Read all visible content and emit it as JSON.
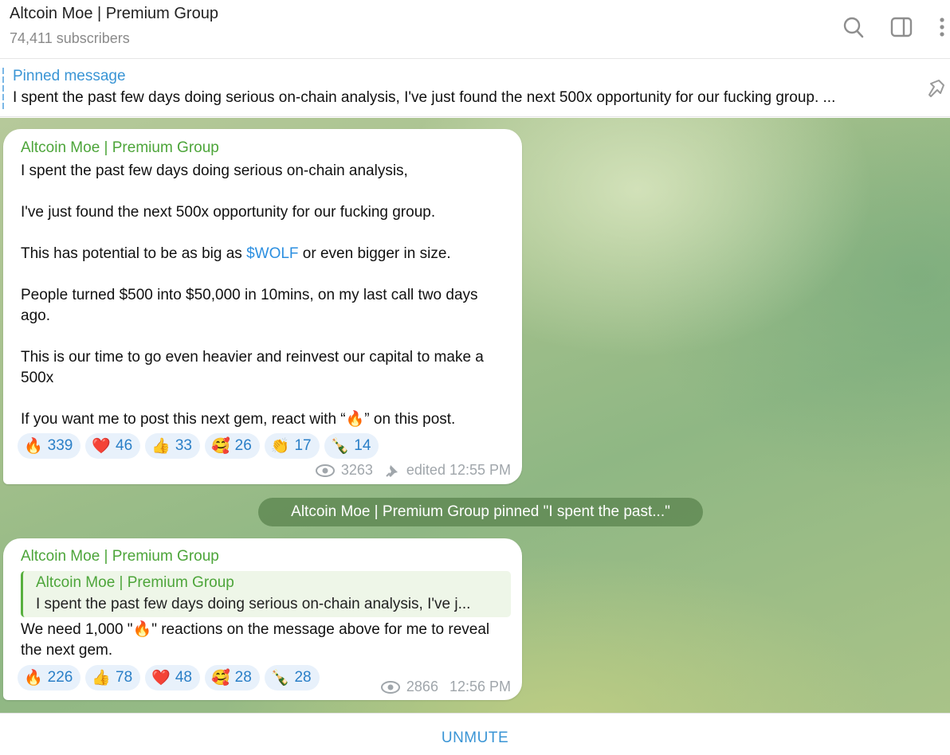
{
  "header": {
    "title": "Altcoin Moe | Premium Group",
    "subscribers": "74,411 subscribers"
  },
  "pinned": {
    "label": "Pinned message",
    "text": "I spent the past few days doing serious on-chain analysis,   I've just found the next 500x opportunity for our fucking group. ..."
  },
  "message1": {
    "sender": "Altcoin Moe | Premium Group",
    "line1": "I spent the past few days doing serious on-chain analysis,",
    "line2": "I've just found the next 500x opportunity for our fucking group.",
    "line3_pre": "This has potential to be as big as ",
    "line3_link": "$WOLF",
    "line3_post": " or even bigger in size.",
    "line4": "People turned $500 into $50,000 in 10mins, on my last call two days ago.",
    "line5": "This is our time to go even heavier and reinvest our capital to make a 500x",
    "line6": "If you want me to post this next gem, react with “🔥” on this post.",
    "reactions": [
      {
        "emoji": "🔥",
        "count": "339"
      },
      {
        "emoji": "❤️",
        "count": "46"
      },
      {
        "emoji": "👍",
        "count": "33"
      },
      {
        "emoji": "🥰",
        "count": "26"
      },
      {
        "emoji": "👏",
        "count": "17"
      },
      {
        "emoji": "🍾",
        "count": "14"
      }
    ],
    "views": "3263",
    "time": "edited 12:55 PM"
  },
  "service": {
    "text": "Altcoin Moe | Premium Group pinned \"I spent the past...\""
  },
  "message2": {
    "sender": "Altcoin Moe | Premium Group",
    "reply_name": "Altcoin Moe | Premium Group",
    "reply_text": "I spent the past few days doing serious on-chain analysis,   I've j...",
    "text": "We need 1,000 \"🔥\" reactions on the message above for me to reveal the next gem.",
    "reactions": [
      {
        "emoji": "🔥",
        "count": "226"
      },
      {
        "emoji": "👍",
        "count": "78"
      },
      {
        "emoji": "❤️",
        "count": "48"
      },
      {
        "emoji": "🥰",
        "count": "28"
      },
      {
        "emoji": "🍾",
        "count": "28"
      }
    ],
    "views": "2866",
    "time": "12:56 PM"
  },
  "footer": {
    "button": "UNMUTE"
  },
  "icons": {
    "header": [
      "search-icon",
      "sidebar-toggle-icon",
      "more-options-icon"
    ],
    "pinned": "pin-icon",
    "meta": [
      "eye-icon",
      "pin-icon"
    ]
  }
}
